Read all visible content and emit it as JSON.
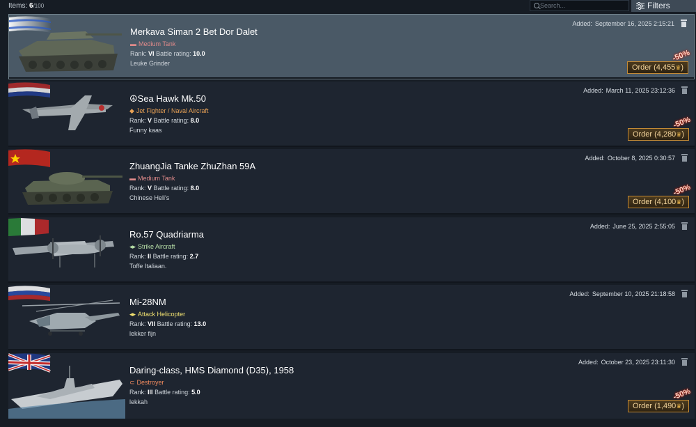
{
  "header": {
    "items_label": "Items:",
    "items_count": "6",
    "items_total": "/100",
    "search_placeholder": "Search...",
    "filters_label": "Filters"
  },
  "colors": {
    "tank": "#e08a8a",
    "aircraft": "#e8a155",
    "strike": "#b8e0a8",
    "heli": "#f0e070",
    "ship": "#f08a5e",
    "order_border": "#c38a35"
  },
  "items": [
    {
      "title": "Merkava Siman 2 Bet Dor Dalet",
      "type_icon": "tank-icon",
      "type_symbol": "▬",
      "type_label": "Medium Tank",
      "rank_label": "Rank:",
      "rank": "VI",
      "br_label": "Battle rating:",
      "br": "10.0",
      "note": "Leuke Grinder",
      "added_label": "Added:",
      "added": "September 16, 2025 2:15:21",
      "order_label": "Order (4,455",
      "order_suffix": ")",
      "gold_icon": "golden-eagle-icon",
      "discount": "-50%",
      "flag": "israel-flag"
    },
    {
      "title": "Sea Hawk Mk.50",
      "title_prefix": "☮",
      "type_icon": "fighter-icon",
      "type_symbol": "◆",
      "type_label": "Jet Fighter / Naval Aircraft",
      "rank_label": "Rank:",
      "rank": "V",
      "br_label": "Battle rating:",
      "br": "8.0",
      "note": "Funny kaas",
      "added_label": "Added:",
      "added": "March 11, 2025 23:12:36",
      "order_label": "Order (4,280",
      "order_suffix": ")",
      "gold_icon": "golden-eagle-icon",
      "discount": "-50%",
      "flag": "netherlands-flag"
    },
    {
      "title": "ZhuangJia Tanke ZhuZhan 59A",
      "type_icon": "tank-icon",
      "type_symbol": "▬",
      "type_label": "Medium Tank",
      "rank_label": "Rank:",
      "rank": "V",
      "br_label": "Battle rating:",
      "br": "8.0",
      "note": "Chinese Heli's",
      "added_label": "Added:",
      "added": "October 8, 2025 0:30:57",
      "order_label": "Order (4,100",
      "order_suffix": ")",
      "gold_icon": "golden-eagle-icon",
      "discount": "-50%",
      "flag": "china-flag"
    },
    {
      "title": "Ro.57 Quadriarma",
      "type_icon": "strike-aircraft-icon",
      "type_symbol": "◂▸",
      "type_label": "Strike Aircraft",
      "rank_label": "Rank:",
      "rank": "II",
      "br_label": "Battle rating:",
      "br": "2.7",
      "note": "Toffe Italiaan.",
      "added_label": "Added:",
      "added": "June 25, 2025 2:55:05",
      "flag": "italy-flag"
    },
    {
      "title": "Mi-28NM",
      "type_icon": "helicopter-icon",
      "type_symbol": "◂▸",
      "type_label": "Attack Helicopter",
      "rank_label": "Rank:",
      "rank": "VII",
      "br_label": "Battle rating:",
      "br": "13.0",
      "note": "lekker fijn",
      "added_label": "Added:",
      "added": "September 10, 2025 21:18:58",
      "flag": "russia-flag"
    },
    {
      "title": "Daring-class, HMS Diamond (D35), 1958",
      "type_icon": "destroyer-icon",
      "type_symbol": "⊂",
      "type_label": "Destroyer",
      "rank_label": "Rank:",
      "rank": "III",
      "br_label": "Battle rating:",
      "br": "5.0",
      "note": "lekkah",
      "added_label": "Added:",
      "added": "October 23, 2025 23:11:30",
      "order_label": "Order (1,490",
      "order_suffix": ")",
      "gold_icon": "golden-eagle-icon",
      "discount": "-50%",
      "flag": "uk-flag"
    }
  ]
}
